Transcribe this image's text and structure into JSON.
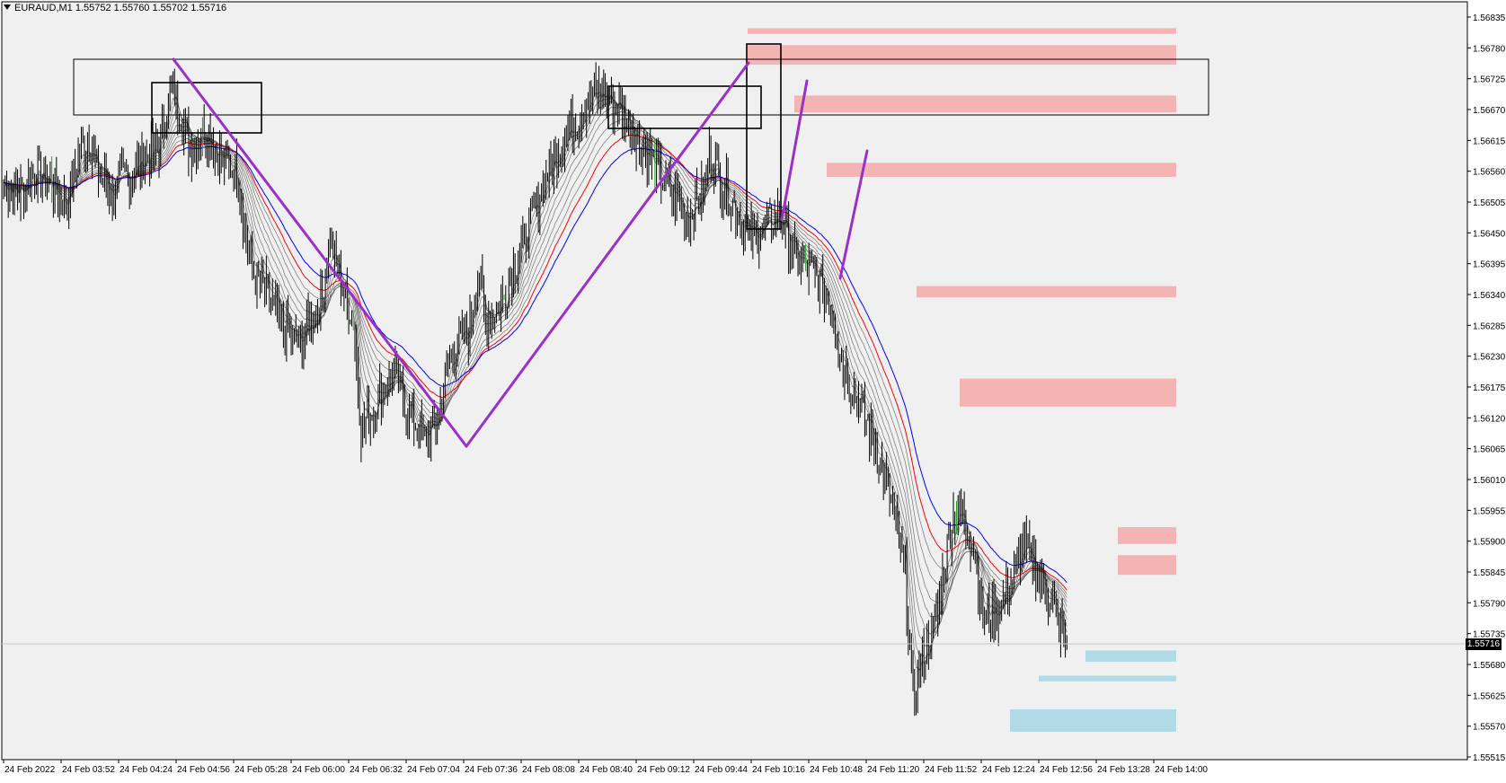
{
  "window": {
    "symbol_line": "EURAUD,M1  1.55752 1.55760 1.55702 1.55716",
    "symbol": "EURAUD",
    "timeframe": "M1",
    "ohlc": {
      "open": 1.55752,
      "high": 1.5576,
      "low": 1.55702,
      "close": 1.55716
    }
  },
  "chart_data": {
    "type": "candlestick",
    "title": "",
    "xlabel": "",
    "ylabel": "",
    "ylim": [
      1.5549,
      1.5688
    ],
    "grid": false,
    "y_ticks": [
      "1.56835",
      "1.56780",
      "1.56725",
      "1.56670",
      "1.56615",
      "1.56560",
      "1.56505",
      "1.56450",
      "1.56395",
      "1.56340",
      "1.56285",
      "1.56230",
      "1.56175",
      "1.56120",
      "1.56065",
      "1.56010",
      "1.55955",
      "1.55900",
      "1.55845",
      "1.55790",
      "1.55735",
      "1.55680",
      "1.55625",
      "1.55570",
      "1.55515"
    ],
    "x_labels": [
      "24 Feb 2022",
      "24 Feb 03:52",
      "24 Feb 04:24",
      "24 Feb 04:56",
      "24 Feb 05:28",
      "24 Feb 06:00",
      "24 Feb 06:32",
      "24 Feb 07:04",
      "24 Feb 07:36",
      "24 Feb 08:08",
      "24 Feb 08:40",
      "24 Feb 09:12",
      "24 Feb 09:44",
      "24 Feb 10:16",
      "24 Feb 10:48",
      "24 Feb 11:20",
      "24 Feb 11:52",
      "24 Feb 12:24",
      "24 Feb 12:56",
      "24 Feb 13:28",
      "24 Feb 14:00"
    ],
    "current_price": "1.55716",
    "price_path": [
      [
        0,
        1.5654
      ],
      [
        10,
        1.5652
      ],
      [
        20,
        1.5656
      ],
      [
        30,
        1.5654
      ],
      [
        40,
        1.565
      ],
      [
        50,
        1.566
      ],
      [
        55,
        1.5662
      ],
      [
        60,
        1.5656
      ],
      [
        70,
        1.5652
      ],
      [
        85,
        1.5657
      ],
      [
        100,
        1.566
      ],
      [
        105,
        1.5668
      ],
      [
        110,
        1.567
      ],
      [
        115,
        1.5665
      ],
      [
        120,
        1.566
      ],
      [
        130,
        1.5664
      ],
      [
        140,
        1.5658
      ],
      [
        150,
        1.5656
      ],
      [
        160,
        1.5638
      ],
      [
        170,
        1.5634
      ],
      [
        180,
        1.5628
      ],
      [
        190,
        1.5625
      ],
      [
        205,
        1.5633
      ],
      [
        210,
        1.5644
      ],
      [
        220,
        1.5633
      ],
      [
        225,
        1.563
      ],
      [
        230,
        1.561
      ],
      [
        240,
        1.5615
      ],
      [
        250,
        1.562
      ],
      [
        260,
        1.5614
      ],
      [
        270,
        1.5608
      ],
      [
        280,
        1.5612
      ],
      [
        285,
        1.562
      ],
      [
        290,
        1.5625
      ],
      [
        300,
        1.5628
      ],
      [
        305,
        1.5638
      ],
      [
        310,
        1.563
      ],
      [
        320,
        1.5632
      ],
      [
        330,
        1.564
      ],
      [
        340,
        1.5648
      ],
      [
        350,
        1.5656
      ],
      [
        360,
        1.5662
      ],
      [
        370,
        1.5666
      ],
      [
        380,
        1.567
      ],
      [
        390,
        1.5669
      ],
      [
        400,
        1.5666
      ],
      [
        410,
        1.5661
      ],
      [
        420,
        1.5656
      ],
      [
        430,
        1.5652
      ],
      [
        440,
        1.5648
      ],
      [
        450,
        1.5652
      ],
      [
        455,
        1.566
      ],
      [
        460,
        1.5655
      ],
      [
        470,
        1.565
      ],
      [
        480,
        1.5644
      ],
      [
        490,
        1.5646
      ],
      [
        500,
        1.5648
      ],
      [
        510,
        1.564
      ],
      [
        520,
        1.5638
      ],
      [
        530,
        1.5634
      ],
      [
        540,
        1.5622
      ],
      [
        550,
        1.5615
      ],
      [
        560,
        1.5608
      ],
      [
        570,
        1.5598
      ],
      [
        580,
        1.5584
      ],
      [
        585,
        1.5562
      ],
      [
        590,
        1.5568
      ],
      [
        600,
        1.5576
      ],
      [
        610,
        1.5594
      ],
      [
        615,
        1.5596
      ],
      [
        625,
        1.5588
      ],
      [
        630,
        1.5576
      ],
      [
        640,
        1.5578
      ],
      [
        650,
        1.5583
      ],
      [
        655,
        1.5589
      ],
      [
        665,
        1.5585
      ],
      [
        675,
        1.5578
      ],
      [
        684,
        1.55716
      ]
    ],
    "moving_averages": [
      {
        "name": "",
        "color": "#0000ff"
      },
      {
        "name": "",
        "color": "#ff0000"
      }
    ],
    "zones": {
      "supply_color": "#f4b0b0",
      "demand_color": "#add8e6",
      "supply": [
        [
          1.56815,
          1.56805
        ],
        [
          1.56785,
          1.5675
        ],
        [
          1.56695,
          1.56665
        ],
        [
          1.56575,
          1.5655
        ],
        [
          1.56355,
          1.56335
        ],
        [
          1.5619,
          1.5614
        ],
        [
          1.55925,
          1.55895
        ],
        [
          1.55875,
          1.5584
        ]
      ],
      "demand": [
        [
          1.55705,
          1.55685
        ],
        [
          1.5566,
          1.5565
        ],
        [
          1.556,
          1.5556
        ]
      ]
    },
    "trendline_color": "#9b30c8"
  }
}
